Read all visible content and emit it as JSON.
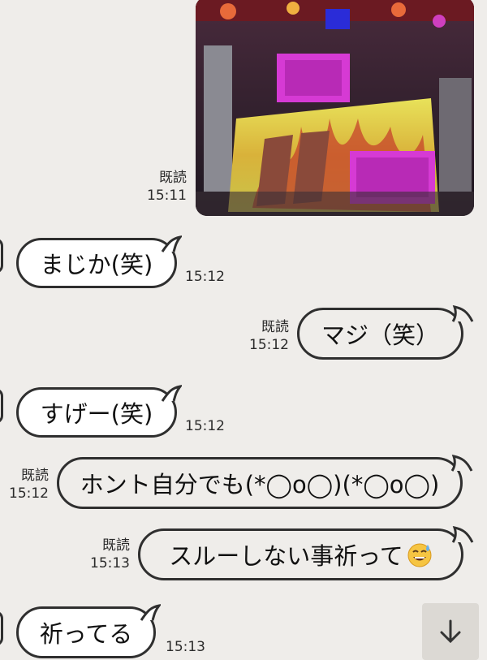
{
  "messages": [
    {
      "id": "m0",
      "side": "sent",
      "type": "image",
      "read": "既読",
      "time": "15:11"
    },
    {
      "id": "m1",
      "side": "received",
      "text": "まじか(笑)",
      "time": "15:12"
    },
    {
      "id": "m2",
      "side": "sent",
      "text": "マジ（笑）",
      "read": "既読",
      "time": "15:12"
    },
    {
      "id": "m3",
      "side": "received",
      "text": "すげー(笑)",
      "time": "15:12"
    },
    {
      "id": "m4",
      "side": "sent",
      "text": "ホント自分でも(*◯o◯)(*◯o◯)",
      "read": "既読",
      "time": "15:12"
    },
    {
      "id": "m5",
      "side": "sent",
      "text": "スルーしない事祈って",
      "emoji": "sweat-smile-emoji",
      "read": "既読",
      "time": "15:13"
    },
    {
      "id": "m6",
      "side": "received",
      "text": "祈ってる",
      "time": "15:13"
    }
  ],
  "colors": {
    "background": "#efedea",
    "bubble_border": "#2f2f2f",
    "bubble_received": "#ffffff",
    "bubble_sent": "#efedea"
  },
  "scroll_button": {
    "icon": "arrow-down-icon"
  }
}
